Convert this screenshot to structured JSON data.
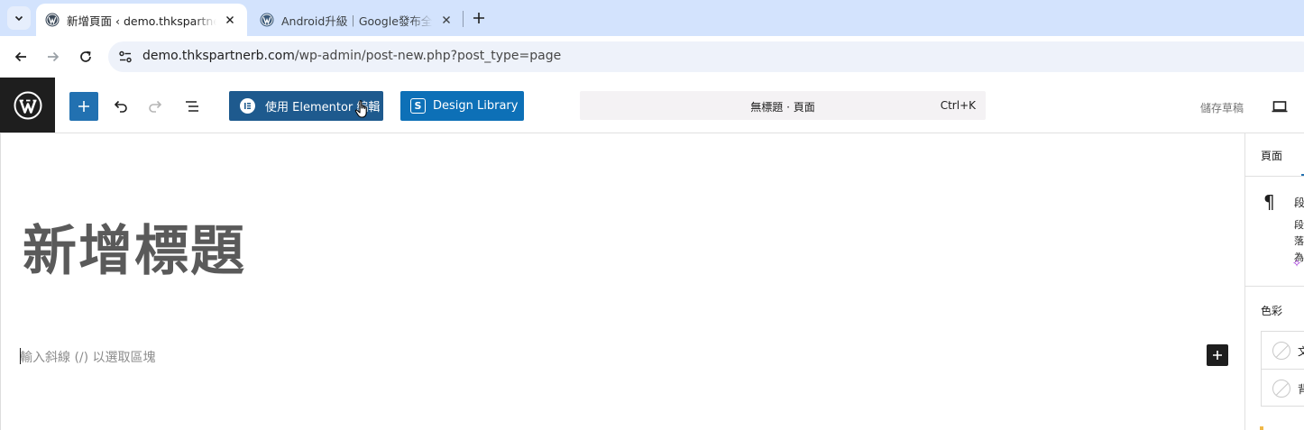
{
  "browser": {
    "tabs": [
      {
        "title": "新增頁面 ‹ demo.thkspartnerb.com — WordPress",
        "active": true,
        "favicon": "wordpress-icon"
      },
      {
        "title": "Android升級｜Google發布全新功能",
        "active": false,
        "favicon": "wordpress-icon"
      }
    ],
    "url_host": "demo.thkspartnerb.com",
    "url_path": "/wp-admin/post-new.php?post_type=page"
  },
  "editor_header": {
    "elementor_button": "使用 Elementor 編輯",
    "design_library_button": "Design Library",
    "document_title": "無標題 · 頁面",
    "shortcut": "Ctrl+K",
    "save_draft": "儲存草稿"
  },
  "canvas": {
    "title_placeholder": "新增標題",
    "block_placeholder": "輸入斜線 (/) 以選取區塊"
  },
  "sidebar": {
    "tab_page": "頁面",
    "block_name": "段落",
    "block_description": "段落為",
    "colors_heading": "色彩",
    "color_text": "文字",
    "color_background": "背景"
  },
  "colors": {
    "accent": "#2271b1",
    "elementor": "#1e5a8e",
    "design_library": "#0d70b7",
    "wp_dark": "#1e1e1e",
    "tabstrip": "#d3e3fd"
  }
}
